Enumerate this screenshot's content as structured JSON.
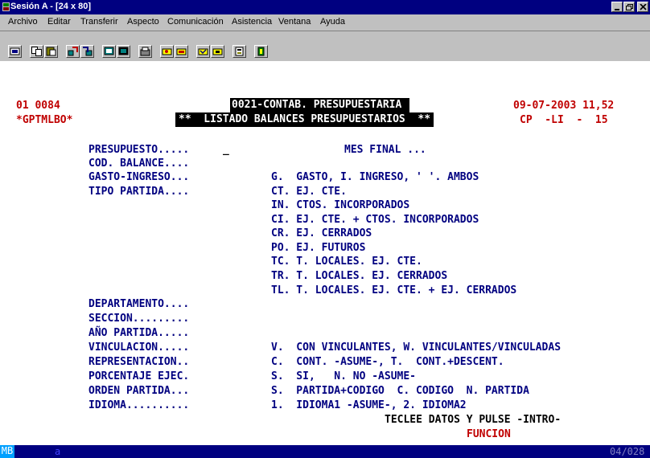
{
  "window": {
    "title": "Sesión A - [24 x 80]"
  },
  "menu": [
    "Archivo",
    "Editar",
    "Transferir",
    "Aspecto",
    "Comunicación",
    "Asistencia",
    "Ventana",
    "Ayuda"
  ],
  "toolbar_icons": [
    "print-screen-icon",
    "copy-icon",
    "paste-icon",
    "send-file-icon",
    "receive-file-icon",
    "display-icon",
    "display-setup-icon",
    "keyboard-map-icon",
    "record-macro-icon",
    "play-macro-icon",
    "stop-macro-icon",
    "customize-icon",
    "clipboard-icon",
    "exit-icon"
  ],
  "screen": {
    "header": {
      "code1": "01 0084",
      "code2": "*GPTMLBO*",
      "title": "0021-CONTAB. PRESUPUESTARIA",
      "subtitle": "**  LISTADO BALANCES PRESUPUESTARIOS  **",
      "datetime": "09-07-2003 11,52",
      "system": "CP  -LI  -  15"
    },
    "fields": {
      "presupuesto": "PRESUPUESTO.....",
      "cursor": "_",
      "mes_final": "MES FINAL ...",
      "cod_balance": "COD. BALANCE....",
      "gasto_ingreso": "GASTO-INGRESO...",
      "tipo_partida": "TIPO PARTIDA....",
      "departamento": "DEPARTAMENTO....",
      "seccion": "SECCION.........",
      "ano_partida": "AÑO PARTIDA.....",
      "vinculacion": "VINCULACION.....",
      "representacion": "REPRESENTACION..",
      "porcentaje": "PORCENTAJE EJEC.",
      "orden_partida": "ORDEN PARTIDA...",
      "idioma": "IDIOMA.........."
    },
    "options": {
      "gasto": "G.  GASTO, I. INGRESO, ' '. AMBOS",
      "tipo": [
        "CT. EJ. CTE.",
        "IN. CTOS. INCORPORADOS",
        "CI. EJ. CTE. + CTOS. INCORPORADOS",
        "CR. EJ. CERRADOS",
        "PO. EJ. FUTUROS",
        "TC. T. LOCALES. EJ. CTE.",
        "TR. T. LOCALES. EJ. CERRADOS",
        "TL. T. LOCALES. EJ. CTE. + EJ. CERRADOS"
      ],
      "vinculacion": "V.  CON VINCULANTES, W. VINCULANTES/VINCULADAS",
      "representacion": "C.  CONT. -ASUME-, T.  CONT.+DESCENT.",
      "porcentaje": "S.  SI,   N. NO -ASUME-",
      "orden": "S.  PARTIDA+CODIGO  C. CODIGO  N. PARTIDA",
      "idioma": "1.  IDIOMA1 -ASUME-, 2. IDIOMA2"
    },
    "footer": {
      "instruction": "TECLEE DATOS Y PULSE -INTRO-",
      "funcion": "FUNCION"
    }
  },
  "status": {
    "mode": "MB",
    "indicator": "a",
    "position": "04/028"
  },
  "colors": {
    "titlebar": "#000080",
    "chrome": "#c0c0c0",
    "terminal_bg": "#ffffff",
    "field_text": "#000080",
    "header_text": "#c00000"
  }
}
